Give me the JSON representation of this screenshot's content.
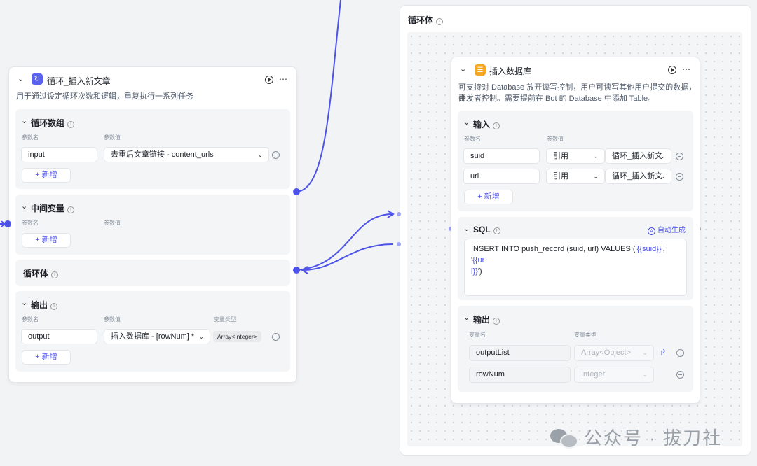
{
  "loop_node": {
    "title": "循环_插入新文章",
    "description": "用于通过设定循环次数和逻辑，重复执行一系列任务",
    "loop_array": {
      "title": "循环数组",
      "col_name": "参数名",
      "col_value": "参数值",
      "row": {
        "name": "input",
        "value": "去重后文章链接 - content_urls"
      },
      "add_label": "新增"
    },
    "intermediate_vars": {
      "title": "中间变量",
      "col_name": "参数名",
      "col_value": "参数值",
      "add_label": "新增"
    },
    "loop_body": {
      "title": "循环体"
    },
    "output": {
      "title": "输出",
      "col_name": "参数名",
      "col_value": "参数值",
      "col_type": "变量类型",
      "row": {
        "name": "output",
        "value": "插入数据库 - [rowNum] *",
        "type": "Array<Integer>"
      },
      "add_label": "新增"
    }
  },
  "body_panel": {
    "title": "循环体"
  },
  "db_node": {
    "title": "插入数据库",
    "description_line1": "可支持对 Database 放开读写控制，用户可读写其他用户提交的数据，由",
    "description_line2": "开发者控制。需要提前在 Bot 的 Database 中添加 Table。",
    "input": {
      "title": "输入",
      "col_name": "参数名",
      "col_value": "参数值",
      "rows": [
        {
          "name": "suid",
          "mode": "引用",
          "ref": "循环_插入新文"
        },
        {
          "name": "url",
          "mode": "引用",
          "ref": "循环_插入新文"
        }
      ],
      "add_label": "新增"
    },
    "sql": {
      "title": "SQL",
      "auto_gen_label": "自动生成",
      "ai_glyph": "A",
      "line1_prefix": "INSERT INTO push_record (suid, url) VALUES ('",
      "var1": "{{suid}}",
      "line1_mid": "', '",
      "var2a": "{{ur",
      "var2b": "l}}",
      "line2_suffix": "')"
    },
    "output": {
      "title": "输出",
      "col_name": "变量名",
      "col_type": "变量类型",
      "rows": [
        {
          "name": "outputList",
          "type": "Array<Object>"
        },
        {
          "name": "rowNum",
          "type": "Integer"
        }
      ]
    }
  },
  "watermark": {
    "text": "公众号 · 拔刀社"
  },
  "colors": {
    "accent": "#4d53e8",
    "loop_icon": "#5a62f0",
    "db_icon": "#f5a623"
  },
  "icons": {
    "chevron": "chevron-down-icon",
    "loop": "loop-icon",
    "database": "database-icon",
    "run": "run-icon",
    "more": "more-icon",
    "info": "info-icon",
    "remove": "minus-circle-icon",
    "add": "plus-icon",
    "branch": "branch-icon"
  }
}
